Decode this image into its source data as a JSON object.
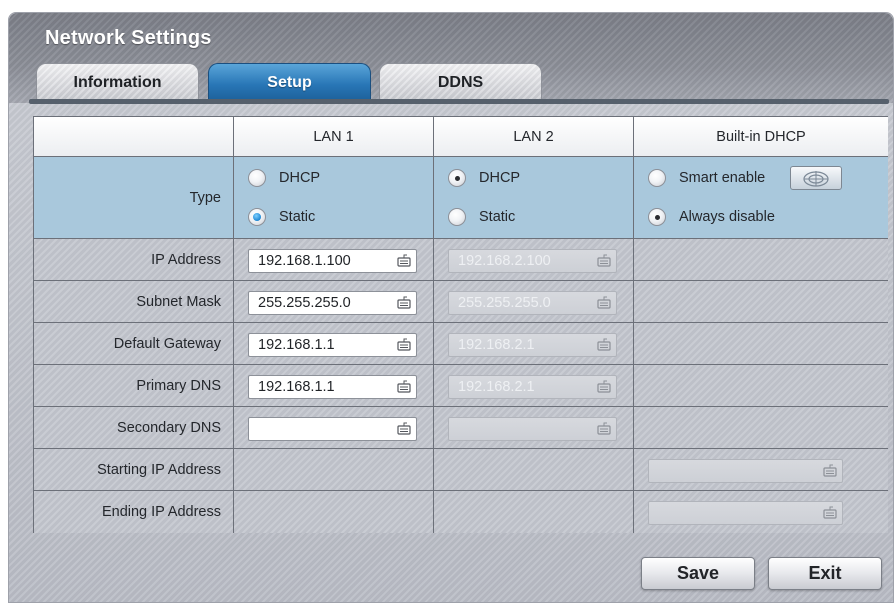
{
  "window": {
    "title": "Network Settings"
  },
  "tabs": [
    {
      "label": "Information",
      "active": false
    },
    {
      "label": "Setup",
      "active": true
    },
    {
      "label": "DDNS",
      "active": false
    }
  ],
  "table": {
    "columns": [
      "LAN 1",
      "LAN 2",
      "Built-in DHCP"
    ],
    "type_label": "Type",
    "row_labels": [
      "IP Address",
      "Subnet Mask",
      "Default Gateway",
      "Primary DNS",
      "Secondary DNS",
      "Starting IP Address",
      "Ending IP Address"
    ],
    "lan1": {
      "type_options": [
        {
          "label": "DHCP",
          "selected": false
        },
        {
          "label": "Static",
          "selected": true
        }
      ],
      "ip_address": "192.168.1.100",
      "subnet_mask": "255.255.255.0",
      "default_gateway": "192.168.1.1",
      "primary_dns": "192.168.1.1",
      "secondary_dns": ""
    },
    "lan2": {
      "type_options": [
        {
          "label": "DHCP",
          "selected": true
        },
        {
          "label": "Static",
          "selected": false
        }
      ],
      "ip_address": "192.168.2.100",
      "subnet_mask": "255.255.255.0",
      "default_gateway": "192.168.2.1",
      "primary_dns": "192.168.2.1",
      "secondary_dns": ""
    },
    "dhcp": {
      "options": [
        {
          "label": "Smart enable",
          "selected": false
        },
        {
          "label": "Always disable",
          "selected": true
        }
      ],
      "starting_ip": "",
      "ending_ip": ""
    }
  },
  "buttons": {
    "save": "Save",
    "exit": "Exit"
  },
  "icons": {
    "field_icon": "keyboard-icon",
    "smart_button_icon": "radar-icon"
  },
  "colors": {
    "active_tab": "#2876b6",
    "type_row_bg": "#a9c8dc",
    "selected_radio": "#1d86d3"
  }
}
